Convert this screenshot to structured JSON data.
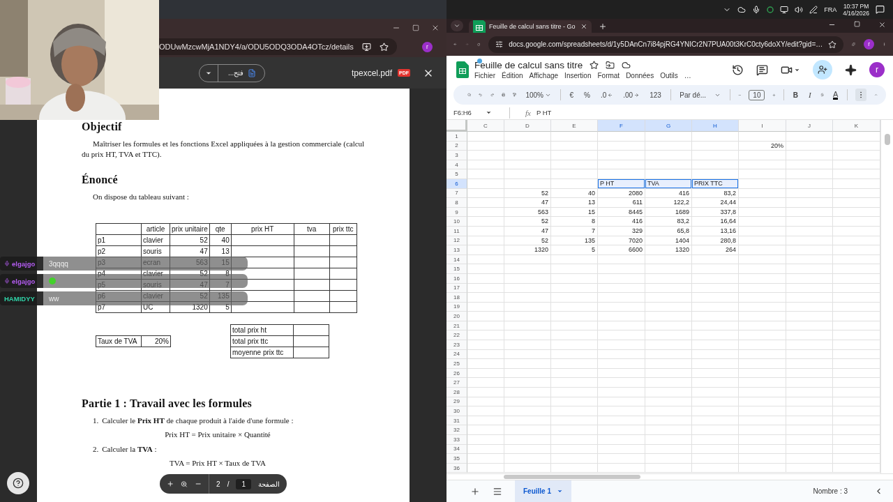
{
  "left_browser": {
    "url": "ODUwMzcwMjA1NDY4/a/ODU5ODQ3ODA4OTcz/details",
    "avatar": "r",
    "pdf_toolbar": {
      "open_with": "فتح...",
      "file_name": "tpexcel.pdf",
      "file_badge": "PDF"
    }
  },
  "pdf": {
    "blocks": [
      {
        "kind": "heading",
        "text": "Objectif"
      },
      {
        "kind": "paragraph",
        "text": "Maîtriser les formules et les fonctions Excel appliquées à la gestion commerciale (calcul du prix HT, TVA et TTC)."
      },
      {
        "kind": "heading",
        "text": "Énoncé"
      },
      {
        "kind": "paragraph",
        "text": "On dispose du tableau suivant :"
      },
      {
        "kind": "table",
        "columns": [
          "",
          "article",
          "prix unitaire",
          "qte",
          "prix HT",
          "tva",
          "prix ttc"
        ],
        "rows": [
          {
            "cells": [
              "p1",
              "clavier",
              "52",
              "40"
            ]
          },
          {
            "cells": [
              "p2",
              "souris",
              "47",
              "13"
            ]
          },
          {
            "cells": [
              "p3",
              "ecran",
              "563",
              "15"
            ]
          },
          {
            "cells": [
              "p4",
              "clavier",
              "52",
              "8"
            ]
          },
          {
            "cells": [
              "p5",
              "souris",
              "47",
              "7"
            ]
          },
          {
            "cells": [
              "p6",
              "clavier",
              "52",
              "135"
            ]
          },
          {
            "cells": [
              "p7",
              "UC",
              "1320",
              "5"
            ]
          }
        ]
      },
      {
        "kind": "summary",
        "rate": {
          "label": "Taux de TVA",
          "value": "20%"
        },
        "totals": [
          "total prix ht",
          "total prix ttc",
          "moyenne prix ttc"
        ]
      },
      {
        "kind": "heading",
        "text": "Partie 1 : Travail avec les formules"
      },
      {
        "kind": "step",
        "number": "1.",
        "text": "Calculer le **Prix HT** de chaque produit à l'aide d'une formule :"
      },
      {
        "kind": "formula",
        "text": "Prix HT = Prix unitaire × Quantité"
      },
      {
        "kind": "step",
        "number": "2.",
        "text": "Calculer la **TVA** :"
      },
      {
        "kind": "formula",
        "text": "TVA = Prix HT × Taux de TVA"
      }
    ]
  },
  "chat": [
    {
      "kind": "text",
      "name": "elgajgo",
      "color": "#b45cf2",
      "badge": true,
      "message": "3qqqq"
    },
    {
      "kind": "emote",
      "name": "elgajgo",
      "color": "#b45cf2",
      "badge": true
    },
    {
      "kind": "text",
      "name": "HAMIDYY",
      "color": "#2fd3a8",
      "badge": false,
      "message": "ww"
    }
  ],
  "pdf_controls": {
    "page_total": "2",
    "separator": "/",
    "page_current": "1",
    "page_label": "الصفحة"
  },
  "taskbar": {
    "language": "FRA",
    "time": "10:37 PM",
    "date": "4/16/2026"
  },
  "right_browser": {
    "tab_title": "Feuille de calcul sans titre - Go",
    "url": "docs.google.com/spreadsheets/d/1y5DAnCn7i84pjRG4YNICr2N7PUA00t3KrC0cty6doXY/edit?gid=…",
    "avatar": "r"
  },
  "sheets": {
    "title": "Feuille de calcul sans titre",
    "menus": [
      "Fichier",
      "Édition",
      "Affichage",
      "Insertion",
      "Format",
      "Données",
      "Outils",
      "…"
    ],
    "avatar": "r",
    "toolbar": {
      "zoom": "100%",
      "currency": "€",
      "percent": "%",
      "decrease_decimals": ".0",
      "increase_decimals": ".00",
      "number_format": "123",
      "font": "Par dé...",
      "font_size": "10",
      "bold": "B",
      "italic": "I",
      "text_color": "A",
      "more_highlighted": true
    },
    "name_box": "F6:H6",
    "formula_label": "fx",
    "formula": "P HT",
    "columns": [
      {
        "label": "C",
        "selected": false
      },
      {
        "label": "D",
        "selected": false
      },
      {
        "label": "E",
        "selected": false
      },
      {
        "label": "F",
        "selected": true
      },
      {
        "label": "G",
        "selected": true
      },
      {
        "label": "H",
        "selected": true
      },
      {
        "label": "I",
        "selected": false
      },
      {
        "label": "J",
        "selected": false
      },
      {
        "label": "K",
        "selected": false
      }
    ],
    "rows": [
      {
        "label": "1",
        "selected": false
      },
      {
        "label": "2",
        "selected": false,
        "cells": [
          null,
          null,
          null,
          null,
          null,
          null,
          {
            "value": "20%",
            "kind": "number",
            "selected": false
          },
          null,
          null
        ]
      },
      {
        "label": "3",
        "selected": false
      },
      {
        "label": "4",
        "selected": false
      },
      {
        "label": "5",
        "selected": false
      },
      {
        "label": "6",
        "selected": true,
        "cells": [
          null,
          null,
          null,
          {
            "value": "P HT",
            "kind": "text",
            "selected": true
          },
          {
            "value": "TVA",
            "kind": "text",
            "selected": true
          },
          {
            "value": "PRIX TTC",
            "kind": "text",
            "selected": true
          },
          null,
          null,
          null
        ]
      },
      {
        "label": "7",
        "selected": false,
        "cells": [
          null,
          {
            "value": "52",
            "kind": "number",
            "selected": false
          },
          {
            "value": "40",
            "kind": "number",
            "selected": false
          },
          {
            "value": "2080",
            "kind": "number",
            "selected": false
          },
          {
            "value": "416",
            "kind": "number",
            "selected": false
          },
          {
            "value": "83,2",
            "kind": "number",
            "selected": false
          },
          null,
          null,
          null
        ]
      },
      {
        "label": "8",
        "selected": false,
        "cells": [
          null,
          {
            "value": "47",
            "kind": "number",
            "selected": false
          },
          {
            "value": "13",
            "kind": "number",
            "selected": false
          },
          {
            "value": "611",
            "kind": "number",
            "selected": false
          },
          {
            "value": "122,2",
            "kind": "number",
            "selected": false
          },
          {
            "value": "24,44",
            "kind": "number",
            "selected": false
          },
          null,
          null,
          null
        ]
      },
      {
        "label": "9",
        "selected": false,
        "cells": [
          null,
          {
            "value": "563",
            "kind": "number",
            "selected": false
          },
          {
            "value": "15",
            "kind": "number",
            "selected": false
          },
          {
            "value": "8445",
            "kind": "number",
            "selected": false
          },
          {
            "value": "1689",
            "kind": "number",
            "selected": false
          },
          {
            "value": "337,8",
            "kind": "number",
            "selected": false
          },
          null,
          null,
          null
        ]
      },
      {
        "label": "10",
        "selected": false,
        "cells": [
          null,
          {
            "value": "52",
            "kind": "number",
            "selected": false
          },
          {
            "value": "8",
            "kind": "number",
            "selected": false
          },
          {
            "value": "416",
            "kind": "number",
            "selected": false
          },
          {
            "value": "83,2",
            "kind": "number",
            "selected": false
          },
          {
            "value": "16,64",
            "kind": "number",
            "selected": false
          },
          null,
          null,
          null
        ]
      },
      {
        "label": "11",
        "selected": false,
        "cells": [
          null,
          {
            "value": "47",
            "kind": "number",
            "selected": false
          },
          {
            "value": "7",
            "kind": "number",
            "selected": false
          },
          {
            "value": "329",
            "kind": "number",
            "selected": false
          },
          {
            "value": "65,8",
            "kind": "number",
            "selected": false
          },
          {
            "value": "13,16",
            "kind": "number",
            "selected": false
          },
          null,
          null,
          null
        ]
      },
      {
        "label": "12",
        "selected": false,
        "cells": [
          null,
          {
            "value": "52",
            "kind": "number",
            "selected": false
          },
          {
            "value": "135",
            "kind": "number",
            "selected": false
          },
          {
            "value": "7020",
            "kind": "number",
            "selected": false
          },
          {
            "value": "1404",
            "kind": "number",
            "selected": false
          },
          {
            "value": "280,8",
            "kind": "number",
            "selected": false
          },
          null,
          null,
          null
        ]
      },
      {
        "label": "13",
        "selected": false,
        "cells": [
          null,
          {
            "value": "1320",
            "kind": "number",
            "selected": false
          },
          {
            "value": "5",
            "kind": "number",
            "selected": false
          },
          {
            "value": "6600",
            "kind": "number",
            "selected": false
          },
          {
            "value": "1320",
            "kind": "number",
            "selected": false
          },
          {
            "value": "264",
            "kind": "number",
            "selected": false
          },
          null,
          null,
          null
        ]
      },
      {
        "label": "14",
        "selected": false
      },
      {
        "label": "15",
        "selected": false
      },
      {
        "label": "16",
        "selected": false
      },
      {
        "label": "17",
        "selected": false
      },
      {
        "label": "18",
        "selected": false
      },
      {
        "label": "19",
        "selected": false
      },
      {
        "label": "20",
        "selected": false
      },
      {
        "label": "21",
        "selected": false
      },
      {
        "label": "22",
        "selected": false
      },
      {
        "label": "23",
        "selected": false
      },
      {
        "label": "24",
        "selected": false
      },
      {
        "label": "25",
        "selected": false
      },
      {
        "label": "26",
        "selected": false
      },
      {
        "label": "27",
        "selected": false
      },
      {
        "label": "28",
        "selected": false
      },
      {
        "label": "29",
        "selected": false
      },
      {
        "label": "30",
        "selected": false
      },
      {
        "label": "31",
        "selected": false
      },
      {
        "label": "32",
        "selected": false
      },
      {
        "label": "33",
        "selected": false
      },
      {
        "label": "34",
        "selected": false
      },
      {
        "label": "35",
        "selected": false
      },
      {
        "label": "36",
        "selected": false
      }
    ],
    "sheet_tabs": [
      {
        "label": "Feuille 1",
        "selected": true
      }
    ],
    "status": "Nombre : 3"
  }
}
